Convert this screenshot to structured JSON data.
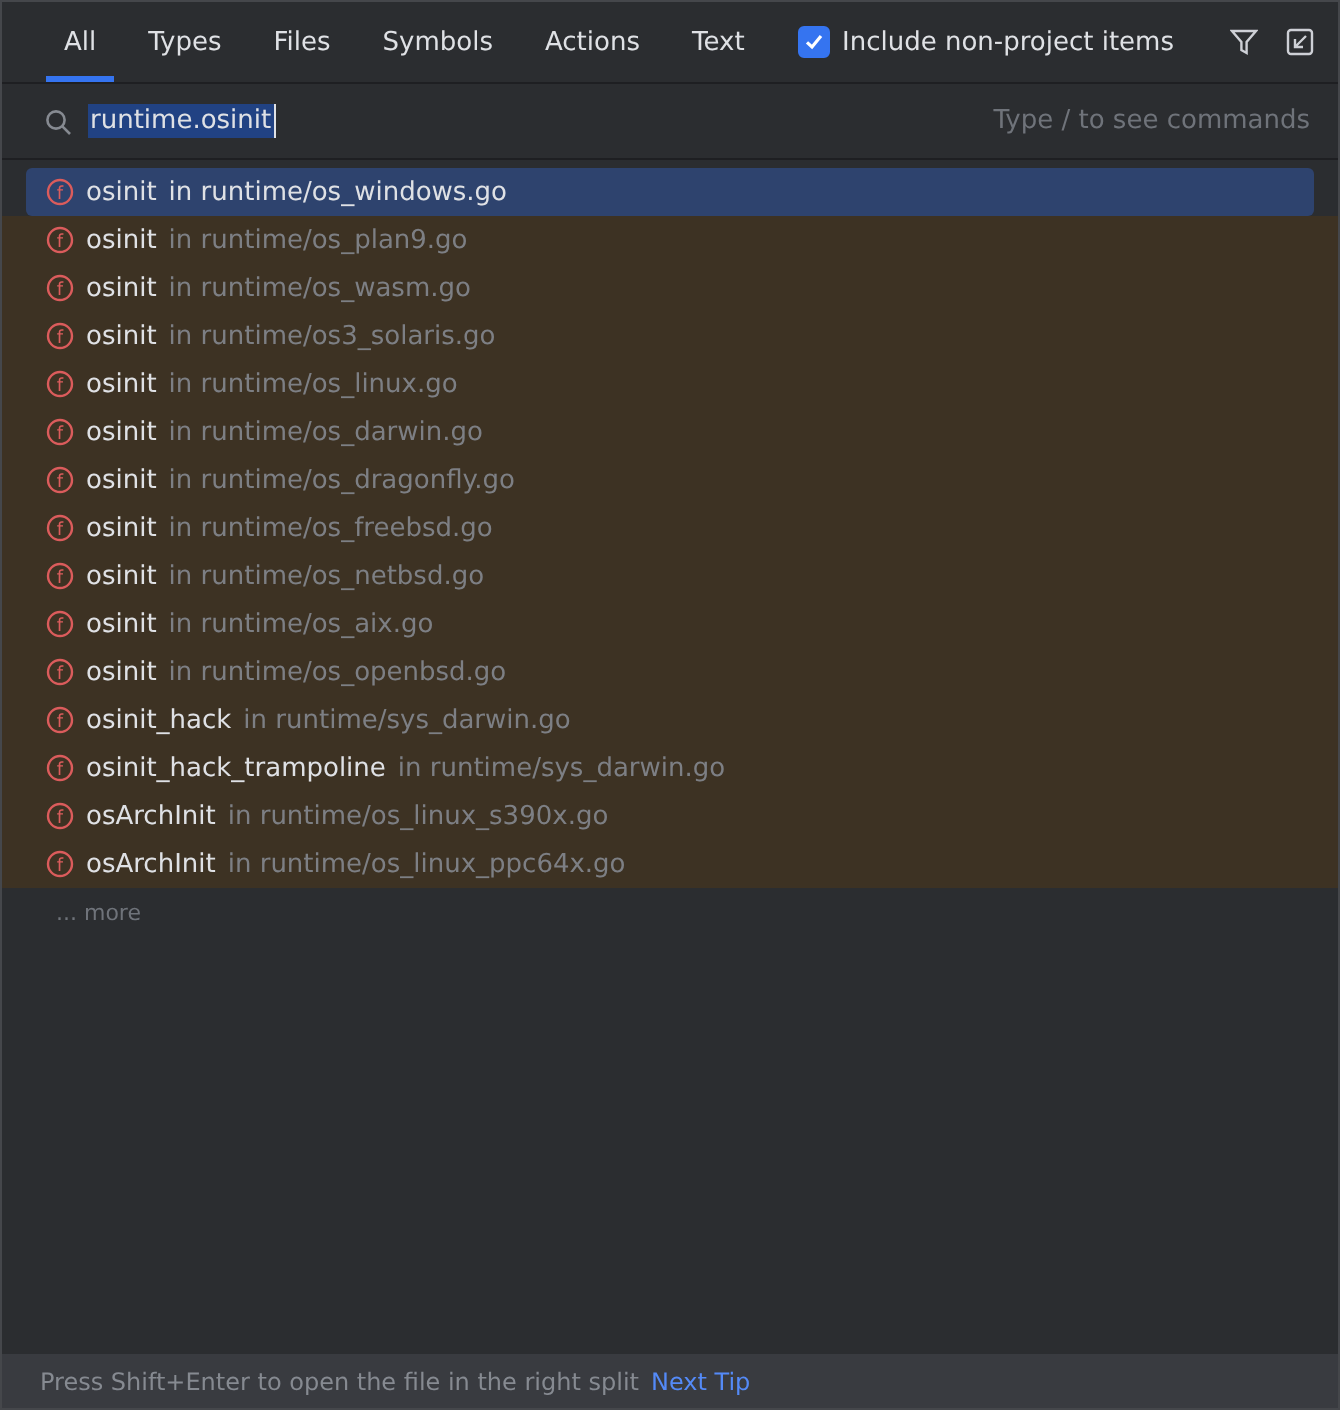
{
  "tabs": [
    {
      "label": "All",
      "selected": true
    },
    {
      "label": "Types",
      "selected": false
    },
    {
      "label": "Files",
      "selected": false
    },
    {
      "label": "Symbols",
      "selected": false
    },
    {
      "label": "Actions",
      "selected": false
    },
    {
      "label": "Text",
      "selected": false
    }
  ],
  "include_non_project": {
    "label": "Include non-project items",
    "checked": true
  },
  "search": {
    "value": "runtime.osinit",
    "hint": "Type / to see commands"
  },
  "results": [
    {
      "icon": "f",
      "name": "osinit",
      "location": "in runtime/os_windows.go",
      "selected": true
    },
    {
      "icon": "f",
      "name": "osinit",
      "location": "in runtime/os_plan9.go",
      "selected": false
    },
    {
      "icon": "f",
      "name": "osinit",
      "location": "in runtime/os_wasm.go",
      "selected": false
    },
    {
      "icon": "f",
      "name": "osinit",
      "location": "in runtime/os3_solaris.go",
      "selected": false
    },
    {
      "icon": "f",
      "name": "osinit",
      "location": "in runtime/os_linux.go",
      "selected": false
    },
    {
      "icon": "f",
      "name": "osinit",
      "location": "in runtime/os_darwin.go",
      "selected": false
    },
    {
      "icon": "f",
      "name": "osinit",
      "location": "in runtime/os_dragonfly.go",
      "selected": false
    },
    {
      "icon": "f",
      "name": "osinit",
      "location": "in runtime/os_freebsd.go",
      "selected": false
    },
    {
      "icon": "f",
      "name": "osinit",
      "location": "in runtime/os_netbsd.go",
      "selected": false
    },
    {
      "icon": "f",
      "name": "osinit",
      "location": "in runtime/os_aix.go",
      "selected": false
    },
    {
      "icon": "f",
      "name": "osinit",
      "location": "in runtime/os_openbsd.go",
      "selected": false
    },
    {
      "icon": "f",
      "name": "osinit_hack",
      "location": "in runtime/sys_darwin.go",
      "selected": false
    },
    {
      "icon": "f",
      "name": "osinit_hack_trampoline",
      "location": "in runtime/sys_darwin.go",
      "selected": false
    },
    {
      "icon": "f",
      "name": "osArchInit",
      "location": "in runtime/os_linux_s390x.go",
      "selected": false
    },
    {
      "icon": "f",
      "name": "osArchInit",
      "location": "in runtime/os_linux_ppc64x.go",
      "selected": false
    }
  ],
  "more": "... more",
  "status_bar": {
    "tip": "Press Shift+Enter to open the file in the right split",
    "link": "Next Tip"
  }
}
